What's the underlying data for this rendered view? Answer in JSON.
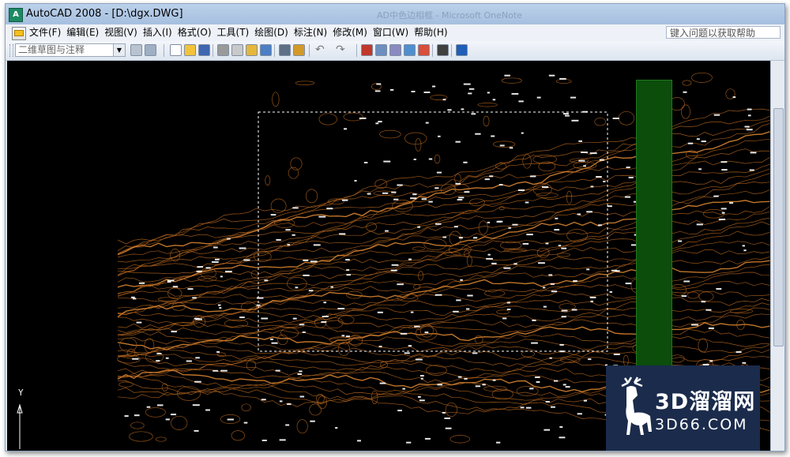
{
  "window": {
    "app_icon_glyph": "A",
    "title": "AutoCAD 2008 - [D:\\dgx.DWG]",
    "background_title": "AD中色边相框 - Microsoft OneNote"
  },
  "menu": {
    "items": [
      "文件(F)",
      "编辑(E)",
      "视图(V)",
      "插入(I)",
      "格式(O)",
      "工具(T)",
      "绘图(D)",
      "标注(N)",
      "修改(M)",
      "窗口(W)",
      "帮助(H)"
    ],
    "help_search_placeholder": "键入问题以获取帮助"
  },
  "toolbar": {
    "workspace_value": "二维草图与注释",
    "buttons": [
      {
        "name": "workspace-settings-button",
        "color": "#b9c3d0"
      },
      {
        "name": "workspace-save-button",
        "color": "#9fb0c5"
      },
      {
        "name": "new-file-button",
        "color": "#ffffff"
      },
      {
        "name": "open-file-button",
        "color": "#f2c33a"
      },
      {
        "name": "save-file-button",
        "color": "#3f66b0"
      },
      {
        "name": "plot-button",
        "color": "#9a9a9a"
      },
      {
        "name": "plot-preview-button",
        "color": "#c9c9c9"
      },
      {
        "name": "publish-button",
        "color": "#e5b73b"
      },
      {
        "name": "3d-dwf-button",
        "color": "#4c7fc4"
      },
      {
        "name": "cut-button",
        "color": "#5e6f86"
      },
      {
        "name": "matchprop-button",
        "color": "#d39a2a"
      },
      {
        "name": "properties-button",
        "color": "#c0392b"
      },
      {
        "name": "design-center-button",
        "color": "#6d8fc0"
      },
      {
        "name": "tool-palettes-button",
        "color": "#8a8ac0"
      },
      {
        "name": "sheet-set-button",
        "color": "#4f8fcf"
      },
      {
        "name": "markup-button",
        "color": "#d84f3a"
      },
      {
        "name": "calculator-button",
        "color": "#404040"
      },
      {
        "name": "help-button",
        "color": "#1f5fb8"
      }
    ],
    "undo_glyph": "↶",
    "redo_glyph": "↷"
  },
  "drawing": {
    "background": "#000000",
    "contour_color": "#b5651d",
    "highlight_color": "#e08a32",
    "point_color": "#ffffff",
    "strip_color": "#0c4d0c",
    "ucs_axis_label": "Y"
  },
  "watermark": {
    "title": "3D溜溜网",
    "subtitle": "3D66.COM",
    "color": "#1b2b4c"
  }
}
